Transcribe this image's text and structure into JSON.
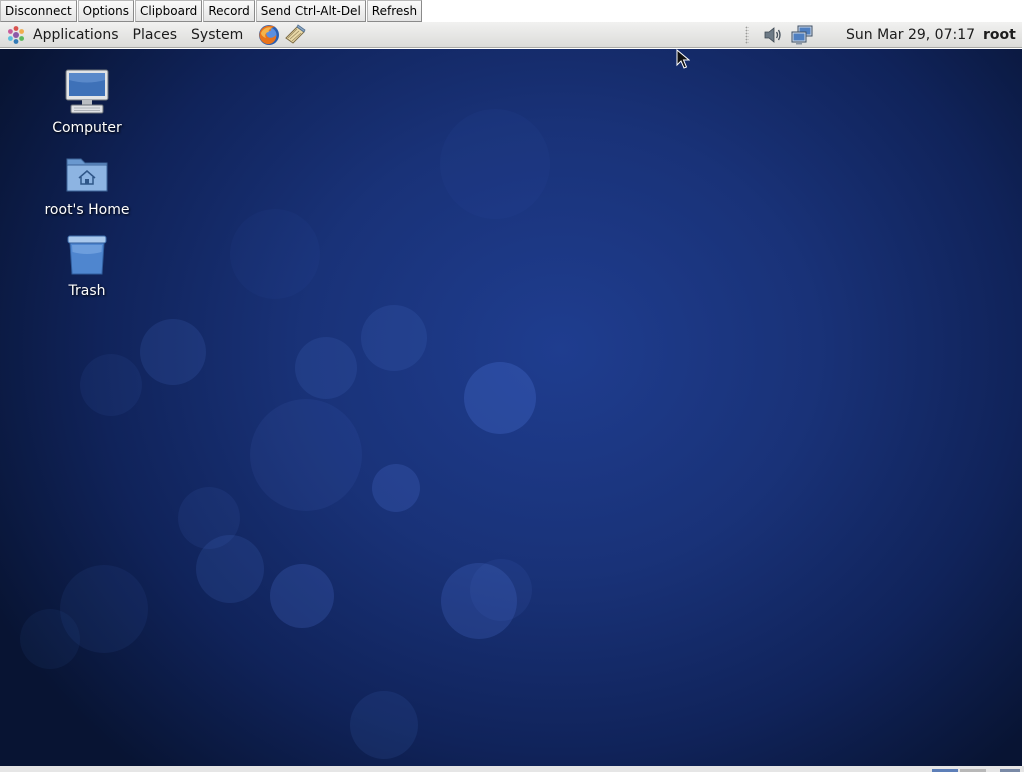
{
  "vnc_toolbar": {
    "buttons": [
      "Disconnect",
      "Options",
      "Clipboard",
      "Record",
      "Send Ctrl-Alt-Del",
      "Refresh"
    ]
  },
  "panel": {
    "menus": [
      "Applications",
      "Places",
      "System"
    ],
    "launchers": [
      "firefox-icon",
      "notes-icon"
    ],
    "tray_icons": [
      "volume-icon",
      "network-icon"
    ],
    "clock": "Sun Mar 29, 07:17",
    "user": "root"
  },
  "desktop": {
    "icons": [
      {
        "label": "Computer",
        "icon": "computer-icon"
      },
      {
        "label": "root's Home",
        "icon": "home-folder-icon"
      },
      {
        "label": "Trash",
        "icon": "trash-icon"
      }
    ]
  },
  "colors": {
    "desktop_center": "#1f3d8f",
    "desktop_edge": "#081433",
    "panel_top": "#f1f1f0",
    "panel_bottom": "#dcdcda"
  }
}
